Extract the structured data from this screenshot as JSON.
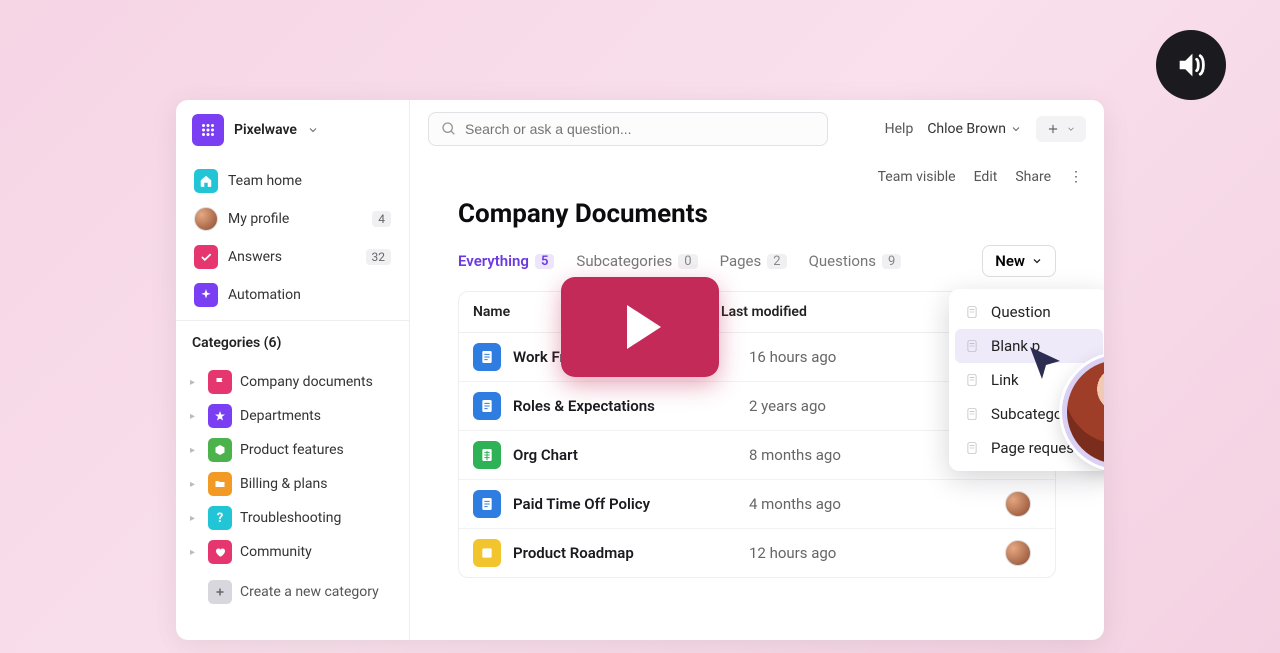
{
  "workspace": {
    "name": "Pixelwave"
  },
  "header": {
    "search_placeholder": "Search or ask a question...",
    "help": "Help",
    "user": "Chloe Brown"
  },
  "toolbar": {
    "visibility": "Team visible",
    "edit": "Edit",
    "share": "Share"
  },
  "sidebar": {
    "nav": {
      "team_home": "Team home",
      "my_profile": "My profile",
      "my_profile_badge": "4",
      "answers": "Answers",
      "answers_badge": "32",
      "automation": "Automation"
    },
    "categories_header": "Categories (6)",
    "categories": [
      {
        "label": "Company documents"
      },
      {
        "label": "Departments"
      },
      {
        "label": "Product features"
      },
      {
        "label": "Billing & plans"
      },
      {
        "label": "Troubleshooting"
      },
      {
        "label": "Community"
      }
    ],
    "create_category": "Create a new category"
  },
  "page": {
    "title": "Company Documents",
    "tabs": {
      "everything": {
        "label": "Everything",
        "count": "5"
      },
      "subcategories": {
        "label": "Subcategories",
        "count": "0"
      },
      "pages": {
        "label": "Pages",
        "count": "2"
      },
      "questions": {
        "label": "Questions",
        "count": "9"
      }
    },
    "new_button": "New",
    "table": {
      "col_name": "Name",
      "col_modified": "Last modified",
      "rows": [
        {
          "name": "Work From Home",
          "modified": "16 hours ago",
          "icon": "blue"
        },
        {
          "name": "Roles & Expectations",
          "modified": "2 years ago",
          "icon": "blue"
        },
        {
          "name": "Org Chart",
          "modified": "8 months ago",
          "icon": "green"
        },
        {
          "name": "Paid Time Off Policy",
          "modified": "4 months ago",
          "icon": "blue"
        },
        {
          "name": "Product Roadmap",
          "modified": "12 hours ago",
          "icon": "yellow"
        }
      ]
    }
  },
  "dropdown": {
    "items": [
      "Question",
      "Blank p",
      "Link",
      "Subcatego",
      "Page reques"
    ]
  }
}
